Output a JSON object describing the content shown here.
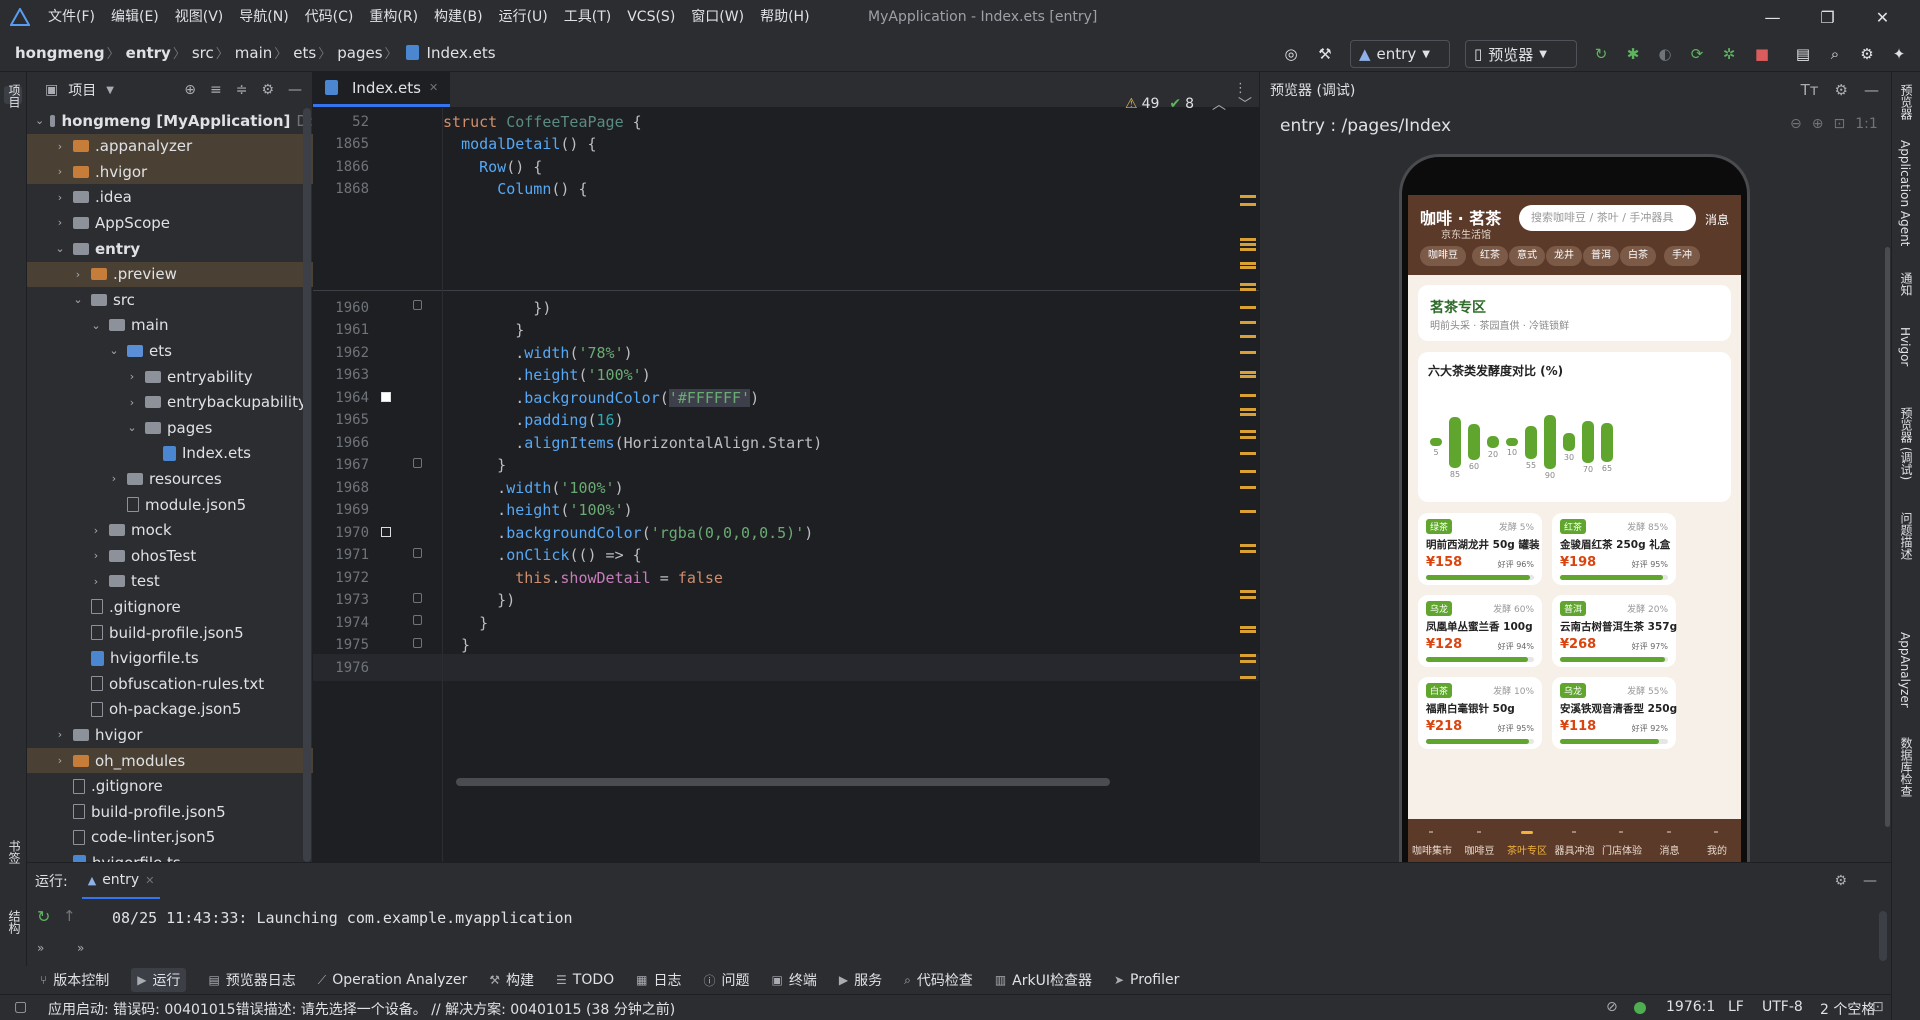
{
  "window": {
    "title": "MyApplication - Index.ets [entry]",
    "menus": [
      "文件(F)",
      "编辑(E)",
      "视图(V)",
      "导航(N)",
      "代码(C)",
      "重构(R)",
      "构建(B)",
      "运行(U)",
      "工具(T)",
      "VCS(S)",
      "窗口(W)",
      "帮助(H)"
    ]
  },
  "breadcrumb": [
    "hongmeng",
    "entry",
    "src",
    "main",
    "ets",
    "pages",
    "Index.ets"
  ],
  "toolbar": {
    "module": "entry",
    "previewer": "预览器"
  },
  "project": {
    "title": "项目",
    "tree": [
      {
        "label": "hongmeng [MyApplication]",
        "suffix": "D:",
        "indent": 0,
        "chev": "⌄",
        "icon": "dir",
        "style": "",
        "bold": true
      },
      {
        "label": ".appanalyzer",
        "indent": 1,
        "chev": "›",
        "icon": "orange",
        "style": "excluded"
      },
      {
        "label": ".hvigor",
        "indent": 1,
        "chev": "›",
        "icon": "orange",
        "style": "excluded"
      },
      {
        "label": ".idea",
        "indent": 1,
        "chev": "›",
        "icon": "dir",
        "style": ""
      },
      {
        "label": "AppScope",
        "indent": 1,
        "chev": "›",
        "icon": "dir",
        "style": ""
      },
      {
        "label": "entry",
        "indent": 1,
        "chev": "⌄",
        "icon": "dir",
        "style": "",
        "bold": true
      },
      {
        "label": ".preview",
        "indent": 2,
        "chev": "›",
        "icon": "orange",
        "style": "excluded"
      },
      {
        "label": "src",
        "indent": 2,
        "chev": "⌄",
        "icon": "dir",
        "style": ""
      },
      {
        "label": "main",
        "indent": 3,
        "chev": "⌄",
        "icon": "dir",
        "style": ""
      },
      {
        "label": "ets",
        "indent": 4,
        "chev": "⌄",
        "icon": "blue",
        "style": ""
      },
      {
        "label": "entryability",
        "indent": 5,
        "chev": "›",
        "icon": "dir",
        "style": ""
      },
      {
        "label": "entrybackupability",
        "indent": 5,
        "chev": "›",
        "icon": "dir",
        "style": ""
      },
      {
        "label": "pages",
        "indent": 5,
        "chev": "⌄",
        "icon": "dir",
        "style": ""
      },
      {
        "label": "Index.ets",
        "indent": 6,
        "chev": "",
        "icon": "ets",
        "style": ""
      },
      {
        "label": "resources",
        "indent": 4,
        "chev": "›",
        "icon": "dir",
        "style": ""
      },
      {
        "label": "module.json5",
        "indent": 4,
        "chev": "",
        "icon": "file",
        "style": ""
      },
      {
        "label": "mock",
        "indent": 3,
        "chev": "›",
        "icon": "dir",
        "style": ""
      },
      {
        "label": "ohosTest",
        "indent": 3,
        "chev": "›",
        "icon": "dir",
        "style": ""
      },
      {
        "label": "test",
        "indent": 3,
        "chev": "›",
        "icon": "dir",
        "style": ""
      },
      {
        "label": ".gitignore",
        "indent": 2,
        "chev": "",
        "icon": "file",
        "style": ""
      },
      {
        "label": "build-profile.json5",
        "indent": 2,
        "chev": "",
        "icon": "file",
        "style": ""
      },
      {
        "label": "hvigorfile.ts",
        "indent": 2,
        "chev": "",
        "icon": "ets",
        "style": ""
      },
      {
        "label": "obfuscation-rules.txt",
        "indent": 2,
        "chev": "",
        "icon": "file",
        "style": ""
      },
      {
        "label": "oh-package.json5",
        "indent": 2,
        "chev": "",
        "icon": "file",
        "style": ""
      },
      {
        "label": "hvigor",
        "indent": 1,
        "chev": "›",
        "icon": "dir",
        "style": ""
      },
      {
        "label": "oh_modules",
        "indent": 1,
        "chev": "›",
        "icon": "orange",
        "style": "excluded"
      },
      {
        "label": ".gitignore",
        "indent": 1,
        "chev": "",
        "icon": "file",
        "style": ""
      },
      {
        "label": "build-profile.json5",
        "indent": 1,
        "chev": "",
        "icon": "file",
        "style": ""
      },
      {
        "label": "code-linter.json5",
        "indent": 1,
        "chev": "",
        "icon": "file",
        "style": ""
      },
      {
        "label": "hvigorfile.ts",
        "indent": 1,
        "chev": "",
        "icon": "ets",
        "style": ""
      }
    ]
  },
  "editor": {
    "tab": "Index.ets",
    "warnings": "49",
    "checks": "8",
    "sticky": [
      {
        "ln": "52",
        "html": "<span class='kw'>struct</span> <span style='color:#5b8b83'>CoffeeTeaPage</span> {",
        "indent": 0
      },
      {
        "ln": "1865",
        "html": "<span class='fn'>modalDetail</span>() {",
        "indent": 1
      },
      {
        "ln": "1866",
        "html": "<span class='fn'>Row</span>() {",
        "indent": 2
      },
      {
        "ln": "1868",
        "html": "<span class='fn'>Column</span>() {",
        "indent": 3
      }
    ],
    "lines": [
      {
        "ln": "1960",
        "html": "})",
        "indent": 5
      },
      {
        "ln": "1961",
        "html": "}",
        "indent": 4
      },
      {
        "ln": "1962",
        "html": ".<span class='fn'>width</span>(<span class='str'>'78%'</span>)",
        "indent": 4
      },
      {
        "ln": "1963",
        "html": ".<span class='fn'>height</span>(<span class='str'>'100%'</span>)",
        "indent": 4
      },
      {
        "ln": "1964",
        "html": ".<span class='fn'>backgroundColor</span>(<span class='str' style='background:#3d3f4a'>'#FFFFFF'</span>)",
        "indent": 4
      },
      {
        "ln": "1965",
        "html": ".<span class='fn'>padding</span>(<span class='num'>16</span>)",
        "indent": 4
      },
      {
        "ln": "1966",
        "html": ".<span class='fn'>alignItems</span>(HorizontalAlign.Start)",
        "indent": 4
      },
      {
        "ln": "1967",
        "html": "}",
        "indent": 3
      },
      {
        "ln": "1968",
        "html": ".<span class='fn'>width</span>(<span class='str'>'100%'</span>)",
        "indent": 3
      },
      {
        "ln": "1969",
        "html": ".<span class='fn'>height</span>(<span class='str'>'100%'</span>)",
        "indent": 3
      },
      {
        "ln": "1970",
        "html": ".<span class='fn'>backgroundColor</span>(<span class='str'>'rgba(0,0,0,0.5)'</span>)",
        "indent": 3
      },
      {
        "ln": "1971",
        "html": ".<span class='fn'>onClick</span>(() => {",
        "indent": 3
      },
      {
        "ln": "1972",
        "html": "<span class='kw'>this</span>.<span class='prop'>showDetail</span> = <span class='kw'>false</span>",
        "indent": 4
      },
      {
        "ln": "1973",
        "html": "})",
        "indent": 3
      },
      {
        "ln": "1974",
        "html": "}",
        "indent": 2
      },
      {
        "ln": "1975",
        "html": "}",
        "indent": 1
      },
      {
        "ln": "1976",
        "html": "",
        "indent": 0
      }
    ]
  },
  "preview": {
    "title": "预览器 (调试)",
    "path": "entry : /pages/Index",
    "app": {
      "brand": "咖啡 · 茗茶",
      "sub": "京东生活馆",
      "search_placeholder": "搜索咖啡豆 / 茶叶 / 手冲器具",
      "msg": "消息",
      "chips": [
        "咖啡豆",
        "红茶",
        "意式",
        "龙井",
        "普洱",
        "白茶",
        "手冲"
      ],
      "section_title": "茗茶专区",
      "section_sub": "明前头采 · 茶园直供 · 冷链锁鲜",
      "chart_title": "六大茶类发酵度对比 (%)"
    },
    "products": [
      {
        "tag": "绿茶",
        "ferm": "发酵 5%",
        "name": "明前西湖龙井 50g 罐装",
        "price": "¥158",
        "rate": "好评 96%",
        "score": 0.96
      },
      {
        "tag": "红茶",
        "ferm": "发酵 85%",
        "name": "金骏眉红茶 250g 礼盒",
        "price": "¥198",
        "rate": "好评 95%",
        "score": 0.95
      },
      {
        "tag": "乌龙",
        "ferm": "发酵 60%",
        "name": "凤凰单丛蜜兰香 100g",
        "price": "¥128",
        "rate": "好评 94%",
        "score": 0.94
      },
      {
        "tag": "普洱",
        "ferm": "发酵 20%",
        "name": "云南古树普洱生茶 357g",
        "price": "¥268",
        "rate": "好评 97%",
        "score": 0.97
      },
      {
        "tag": "白茶",
        "ferm": "发酵 10%",
        "name": "福鼎白毫银针 50g",
        "price": "¥218",
        "rate": "好评 95%",
        "score": 0.95
      },
      {
        "tag": "乌龙",
        "ferm": "发酵 55%",
        "name": "安溪铁观音清香型 250g",
        "price": "¥118",
        "rate": "好评 92%",
        "score": 0.92
      }
    ],
    "bottom_nav": [
      "咖啡集市",
      "咖啡豆",
      "茶叶专区",
      "器具冲泡",
      "门店体验",
      "消息",
      "我的"
    ],
    "bottom_active": 2
  },
  "chart_data": {
    "type": "bar",
    "title": "六大茶类发酵度对比 (%)",
    "values": [
      5,
      85,
      60,
      20,
      10,
      55,
      90,
      30,
      70,
      65
    ],
    "ylim": [
      0,
      100
    ]
  },
  "run": {
    "label": "运行:",
    "config": "entry",
    "log": "08/25 11:43:33: Launching com.example.myapplication"
  },
  "bottom_tools": [
    "版本控制",
    "运行",
    "预览器日志",
    "Operation Analyzer",
    "构建",
    "TODO",
    "日志",
    "问题",
    "终端",
    "服务",
    "代码检查",
    "ArkUI检查器",
    "Profiler"
  ],
  "bottom_active": 1,
  "status": {
    "message": "应用启动: 错误码: 00401015错误描述: 请先选择一个设备。 // 解决方案: 00401015 (38 分钟之前)",
    "position": "1976:1",
    "line_sep": "LF",
    "encoding": "UTF-8",
    "indent": "2 个空格"
  },
  "side_tabs": {
    "left": [
      "项目",
      "书签",
      "结构"
    ],
    "right": [
      "预览器",
      "Application Agent",
      "通知",
      "Hvigor",
      "预览器 (调试)",
      "问题描述",
      "AppAnalyzer",
      "数据库检查"
    ]
  }
}
